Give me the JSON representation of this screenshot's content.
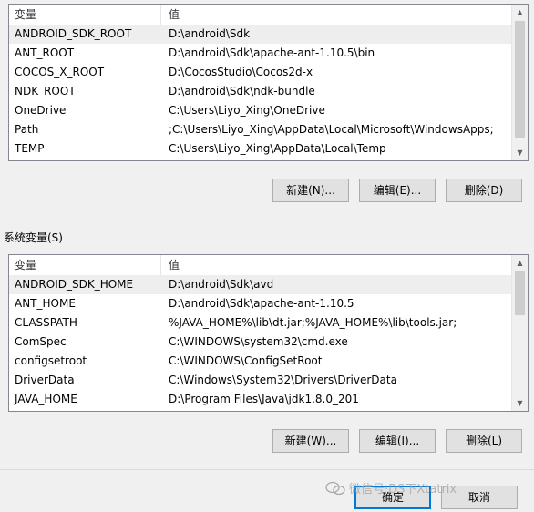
{
  "user_vars": {
    "col_name": "变量",
    "col_value": "值",
    "rows": [
      {
        "name": "ANDROID_SDK_ROOT",
        "value": "D:\\android\\Sdk"
      },
      {
        "name": "ANT_ROOT",
        "value": "D:\\android\\Sdk\\apache-ant-1.10.5\\bin"
      },
      {
        "name": "COCOS_X_ROOT",
        "value": "D:\\CocosStudio\\Cocos2d-x"
      },
      {
        "name": "NDK_ROOT",
        "value": "D:\\android\\Sdk\\ndk-bundle"
      },
      {
        "name": "OneDrive",
        "value": "C:\\Users\\Liyo_Xing\\OneDrive"
      },
      {
        "name": "Path",
        "value": ";C:\\Users\\Liyo_Xing\\AppData\\Local\\Microsoft\\WindowsApps;"
      },
      {
        "name": "TEMP",
        "value": "C:\\Users\\Liyo_Xing\\AppData\\Local\\Temp"
      }
    ],
    "new_label": "新建(N)...",
    "edit_label": "编辑(E)...",
    "delete_label": "删除(D)"
  },
  "system_vars": {
    "group_label": "系统变量(S)",
    "col_name": "变量",
    "col_value": "值",
    "rows": [
      {
        "name": "ANDROID_SDK_HOME",
        "value": "D:\\android\\Sdk\\avd"
      },
      {
        "name": "ANT_HOME",
        "value": "D:\\android\\Sdk\\apache-ant-1.10.5"
      },
      {
        "name": "CLASSPATH",
        "value": "%JAVA_HOME%\\lib\\dt.jar;%JAVA_HOME%\\lib\\tools.jar;"
      },
      {
        "name": "ComSpec",
        "value": "C:\\WINDOWS\\system32\\cmd.exe"
      },
      {
        "name": "configsetroot",
        "value": "C:\\WINDOWS\\ConfigSetRoot"
      },
      {
        "name": "DriverData",
        "value": "C:\\Windows\\System32\\Drivers\\DriverData"
      },
      {
        "name": "JAVA_HOME",
        "value": "D:\\Program Files\\Java\\jdk1.8.0_201"
      }
    ],
    "new_label": "新建(W)...",
    "edit_label": "编辑(I)...",
    "delete_label": "删除(L)"
  },
  "footer": {
    "ok_label": "确定",
    "cancel_label": "取消"
  },
  "watermark": {
    "text": "微信号·DS下Xtatrix"
  },
  "icons": {
    "scroll_up": "scroll-up-icon",
    "scroll_down": "scroll-down-icon",
    "watermark_logo": "wechat-logo-icon"
  }
}
